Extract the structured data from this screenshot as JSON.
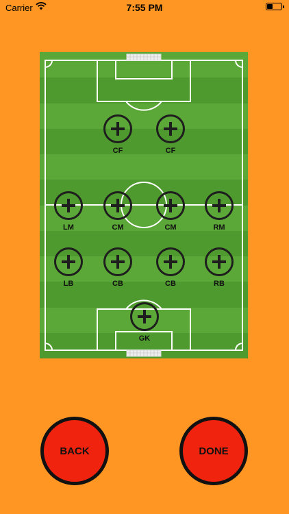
{
  "status_bar": {
    "carrier": "Carrier",
    "time": "7:55 PM",
    "wifi_icon": "wifi-icon",
    "battery_level": 0.4
  },
  "pitch": {
    "grass_light": "#5BA838",
    "grass_dark": "#4E9A2E",
    "line_color": "#FFFFFF"
  },
  "positions": [
    {
      "label": "CF"
    },
    {
      "label": "CF"
    },
    {
      "label": "LM"
    },
    {
      "label": "CM"
    },
    {
      "label": "CM"
    },
    {
      "label": "RM"
    },
    {
      "label": "LB"
    },
    {
      "label": "CB"
    },
    {
      "label": "CB"
    },
    {
      "label": "RB"
    },
    {
      "label": "GK"
    }
  ],
  "actions": {
    "back_label": "BACK",
    "done_label": "DONE",
    "button_color": "#F0240E",
    "background_color": "#FF9624"
  }
}
